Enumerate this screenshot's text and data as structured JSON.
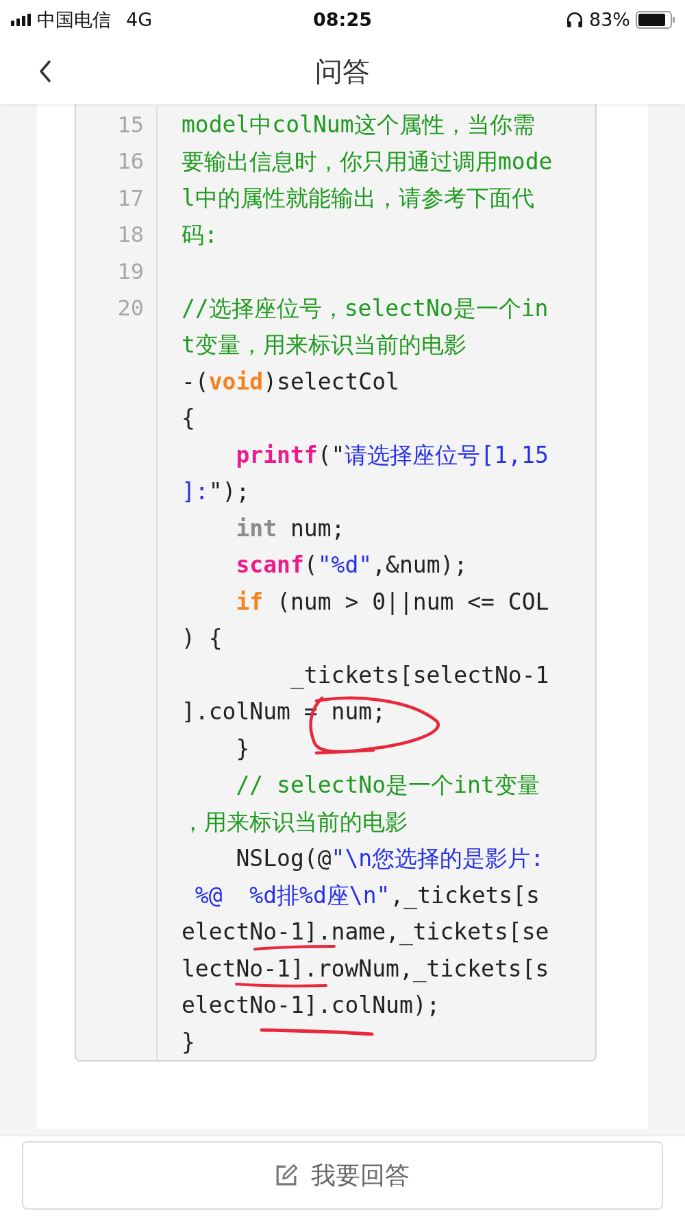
{
  "status_bar": {
    "carrier": "中国电信",
    "network": "4G",
    "time": "08:25",
    "battery_percent": "83%"
  },
  "nav_bar": {
    "title": "问答"
  },
  "code": {
    "lines": [
      {
        "number": "15",
        "segments": [
          {
            "kind": "comment",
            "text": "model中colNum这个属性，当你需"
          }
        ]
      },
      {
        "number": "16",
        "segments": [
          {
            "kind": "comment",
            "text": "要输出信息时，你只用通过调用mode"
          }
        ]
      },
      {
        "number": "17",
        "segments": [
          {
            "kind": "comment",
            "text": "l中的属性就能输出，请参考下面代"
          }
        ]
      },
      {
        "number": "18",
        "segments": [
          {
            "kind": "comment",
            "text": "码:"
          }
        ]
      },
      {
        "number": "19"
      },
      {
        "number": "20",
        "segments": [
          {
            "kind": "comment",
            "text": "//选择座位号，selectNo是一个in"
          }
        ]
      },
      {
        "segments": [
          {
            "kind": "comment",
            "text": "t变量，用来标识当前的电影"
          }
        ]
      },
      {
        "segments": [
          {
            "kind": "plain",
            "text": "-("
          },
          {
            "kind": "keyword",
            "text": "void"
          },
          {
            "kind": "plain",
            "text": ")selectCol"
          }
        ]
      },
      {
        "segments": [
          {
            "kind": "plain",
            "text": "{"
          }
        ]
      },
      {
        "segments": [
          {
            "kind": "function",
            "text": "    printf"
          },
          {
            "kind": "plain",
            "text": "(\""
          },
          {
            "kind": "string",
            "text": "请选择座位号[1,15"
          }
        ]
      },
      {
        "segments": [
          {
            "kind": "string",
            "text": "]:"
          },
          {
            "kind": "plain",
            "text": "\");"
          }
        ]
      },
      {
        "segments": [
          {
            "kind": "type",
            "text": "    int"
          },
          {
            "kind": "plain",
            "text": " num;"
          }
        ]
      },
      {
        "segments": [
          {
            "kind": "function",
            "text": "    scanf"
          },
          {
            "kind": "plain",
            "text": "("
          },
          {
            "kind": "string",
            "text": "\"%d\""
          },
          {
            "kind": "plain",
            "text": ",&num);"
          }
        ]
      },
      {
        "segments": [
          {
            "kind": "keyword",
            "text": "    if"
          },
          {
            "kind": "plain",
            "text": " (num > 0||num <= COL"
          }
        ]
      },
      {
        "segments": [
          {
            "kind": "plain",
            "text": ") {"
          }
        ]
      },
      {
        "segments": [
          {
            "kind": "plain",
            "text": "        _tickets[selectNo-1"
          }
        ]
      },
      {
        "segments": [
          {
            "kind": "plain",
            "text": "].colNum = num;"
          }
        ]
      },
      {
        "segments": [
          {
            "kind": "plain",
            "text": "    }"
          }
        ]
      },
      {
        "segments": [
          {
            "kind": "comment",
            "text": "    // selectNo是一个int变量"
          }
        ]
      },
      {
        "segments": [
          {
            "kind": "comment",
            "text": "，用来标识当前的电影"
          }
        ]
      },
      {
        "segments": [
          {
            "kind": "plain",
            "text": "    NSLog(@"
          },
          {
            "kind": "string",
            "text": "\"\\n您选择的是影片:"
          }
        ]
      },
      {
        "segments": [
          {
            "kind": "string",
            "text": " %@  %d排%d座\\n\""
          },
          {
            "kind": "plain",
            "text": ",_tickets[s"
          }
        ]
      },
      {
        "segments": [
          {
            "kind": "plain",
            "text": "electNo-1].name,_tickets[se"
          }
        ]
      },
      {
        "segments": [
          {
            "kind": "plain",
            "text": "lectNo-1].rowNum,_tickets[s"
          }
        ]
      },
      {
        "segments": [
          {
            "kind": "plain",
            "text": "electNo-1].colNum);"
          }
        ]
      },
      {
        "segments": [
          {
            "kind": "plain",
            "text": "}"
          }
        ]
      }
    ]
  },
  "answer_button": {
    "label": "我要回答"
  }
}
